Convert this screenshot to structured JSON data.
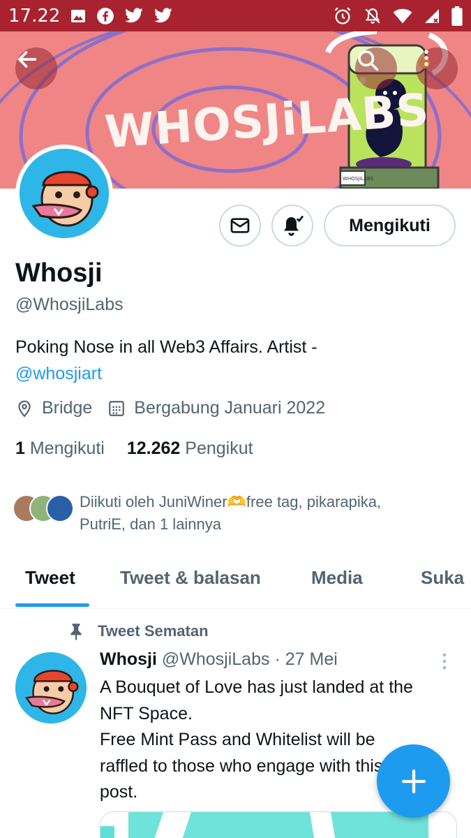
{
  "status_bar": {
    "time": "17.22",
    "left_icons": [
      "image-icon",
      "facebook-icon",
      "twitter-icon",
      "twitter-icon"
    ],
    "right_icons": [
      "alarm-icon",
      "notifications-off-icon",
      "wifi-icon",
      "signal-icon",
      "battery-icon"
    ]
  },
  "banner": {
    "text": "WHOSJiLABS",
    "jar_label": "WHOSJiLABS",
    "bg_color": "#f08585"
  },
  "toolbar": {
    "back_icon": "arrow-left-icon",
    "search_icon": "search-icon",
    "more_icon": "more-vertical-icon"
  },
  "profile": {
    "name": "Whosji",
    "handle": "@WhosjiLabs",
    "bio_text": "Poking Nose in all Web3 Affairs. Artist -",
    "bio_link": "@whosjiart",
    "location": "Bridge",
    "joined": "Bergabung Januari 2022",
    "following_count": "1",
    "following_label": "Mengikuti",
    "followers_count": "12.262",
    "followers_label": "Pengikut",
    "followed_by_line1": "Diikuti oleh JuniWiner🫶free tag, pikarapika,",
    "followed_by_line2": "PutriE, dan 1 lainnya"
  },
  "actions": {
    "message_icon": "mail-icon",
    "notify_icon": "bell-check-icon",
    "follow_label": "Mengikuti"
  },
  "tabs": [
    {
      "label": "Tweet",
      "active": true
    },
    {
      "label": "Tweet & balasan",
      "active": false
    },
    {
      "label": "Media",
      "active": false
    },
    {
      "label": "Suka",
      "active": false
    }
  ],
  "pinned_tweet": {
    "pinned_label": "Tweet Sematan",
    "author_name": "Whosji",
    "author_handle": "@WhosjiLabs",
    "separator": "·",
    "date": "27 Mei",
    "text_line1": "A Bouquet of Love has just landed at the",
    "text_line2": "NFT Space.",
    "text_line3": "Free Mint Pass and Whitelist will be",
    "text_line4": "raffled to those who engage with this",
    "text_line5": "post."
  },
  "fab": {
    "icon": "plus-icon"
  },
  "colors": {
    "status_bar": "#a8232f",
    "accent": "#1d9bf0",
    "secondary_text": "#536471",
    "avatar_bg": "#2fb6e8"
  }
}
